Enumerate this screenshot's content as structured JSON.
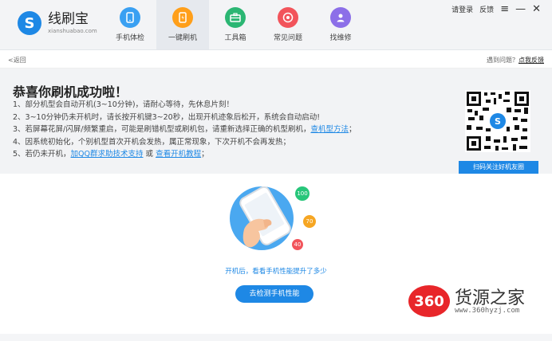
{
  "app": {
    "name": "线刷宝",
    "domain": "xianshuabao.com"
  },
  "nav": {
    "items": [
      {
        "label": "手机体检",
        "color": "#3aa0f2",
        "icon": "phone-check-icon"
      },
      {
        "label": "一键刷机",
        "color": "#ff9f1a",
        "icon": "flash-phone-icon",
        "active": true
      },
      {
        "label": "工具箱",
        "color": "#2bb673",
        "icon": "toolbox-icon"
      },
      {
        "label": "常见问题",
        "color": "#f2545b",
        "icon": "question-icon"
      },
      {
        "label": "找维修",
        "color": "#8c6fe8",
        "icon": "repair-icon"
      }
    ]
  },
  "window_controls": {
    "login": "请登录",
    "feedback": "反馈"
  },
  "subbar": {
    "back": "<返回",
    "problem_text": "遇到问题？",
    "feedback_link": "点我反馈"
  },
  "success": {
    "title": "恭喜你刷机成功啦！",
    "steps": [
      {
        "text": "1、部分机型会自动开机(3~10分钟)，请耐心等待，先休息片刻！"
      },
      {
        "text": "2、3~10分钟仍未开机时，请长按开机键3~20秒，出现开机迹象后松开，系统会自动启动!"
      },
      {
        "text": "3、若屏幕花屏/闪屏/频繁重启，可能是刷错机型或刷机包，请重新选择正确的机型刷机，",
        "link": "查机型方法",
        "suffix": "；"
      },
      {
        "text": "4、因系统初始化，个别机型首次开机会发热，属正常现象，下次开机不会再发热；"
      },
      {
        "text": "5、若仍未开机，",
        "link": "加QQ群求助技术支持",
        "middle": " 或 ",
        "link2": "查看开机教程",
        "suffix": "；"
      }
    ],
    "qr_button": "扫码关注好机友圈"
  },
  "performance": {
    "badges": [
      "100",
      "70",
      "40"
    ],
    "hint": "开机后，看看手机性能提升了多少",
    "button": "去检测手机性能"
  },
  "watermark": {
    "logo": "360",
    "name": "货源之家",
    "url": "www.360hyzj.com"
  },
  "colors": {
    "accent": "#1e88e5",
    "panel_bg": "#f2f3f5",
    "watermark_red": "#e8262a"
  }
}
